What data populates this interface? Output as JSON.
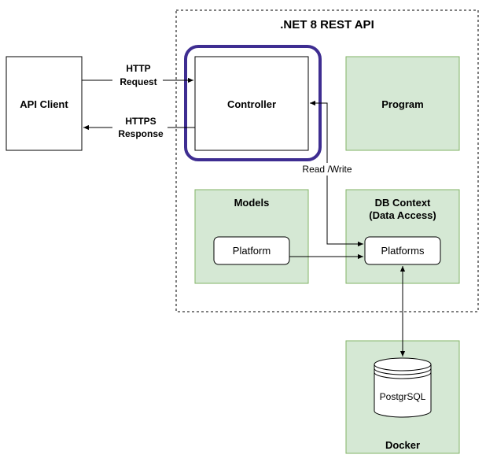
{
  "diagram": {
    "api_title": ".NET 8 REST API",
    "api_client": "API Client",
    "controller": "Controller",
    "program": "Program",
    "models": {
      "title": "Models",
      "item": "Platform"
    },
    "db_context": {
      "title_line1": "DB Context",
      "title_line2": "(Data Access)",
      "item": "Platforms"
    },
    "docker": {
      "title": "Docker",
      "database": "PostgrSQL"
    },
    "edges": {
      "request_line1": "HTTP",
      "request_line2": "Request",
      "response_line1": "HTTPS",
      "response_line2": "Response",
      "read_write": "Read /Write"
    }
  },
  "colors": {
    "green_fill": "#d5e8d4",
    "green_stroke": "#82b366",
    "highlight": "#3e2d91",
    "line": "#000000"
  }
}
